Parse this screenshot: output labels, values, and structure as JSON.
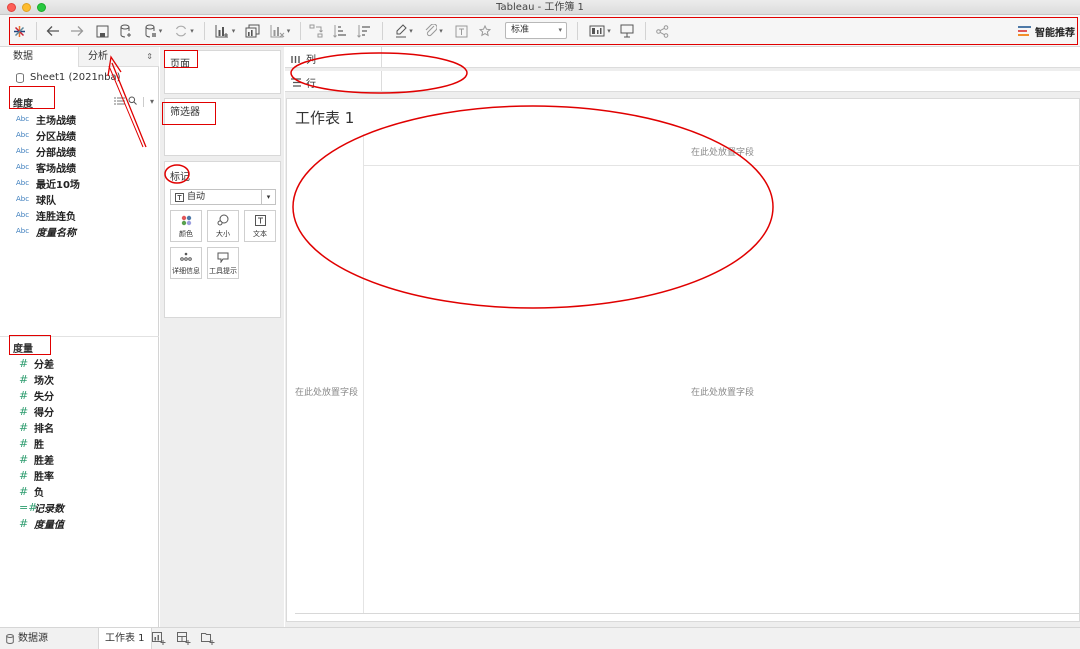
{
  "window": {
    "title": "Tableau - 工作簿 1"
  },
  "toolbar": {
    "fit_value": "标准",
    "show_me_label": "智能推荐",
    "icons": [
      "tableau-logo-icon",
      "undo-icon",
      "redo-icon",
      "save-icon",
      "new-datasource-icon",
      "pause-updates-icon",
      "refresh-icon",
      "new-worksheet-icon",
      "duplicate-sheet-icon",
      "clear-sheet-icon",
      "swap-icon",
      "sort-ascending-icon",
      "sort-descending-icon",
      "highlight-icon",
      "group-icon",
      "label-icon",
      "pin-icon",
      "show-cards-icon",
      "presentation-icon",
      "share-icon"
    ]
  },
  "data_pane": {
    "tab_data": "数据",
    "tab_analysis": "分析",
    "datasource": "Sheet1 (2021nba)",
    "dimensions_title": "维度",
    "dimensions": [
      {
        "type": "Abc",
        "name": "主场战绩",
        "style": "normal"
      },
      {
        "type": "Abc",
        "name": "分区战绩",
        "style": "normal"
      },
      {
        "type": "Abc",
        "name": "分部战绩",
        "style": "normal"
      },
      {
        "type": "Abc",
        "name": "客场战绩",
        "style": "normal"
      },
      {
        "type": "Abc",
        "name": "最近10场",
        "style": "normal"
      },
      {
        "type": "Abc",
        "name": "球队",
        "style": "normal"
      },
      {
        "type": "Abc",
        "name": "连胜连负",
        "style": "normal"
      },
      {
        "type": "Abc",
        "name": "度量名称",
        "style": "italic"
      }
    ],
    "measures_title": "度量",
    "measures": [
      {
        "type": "#",
        "name": "分差",
        "style": "normal"
      },
      {
        "type": "#",
        "name": "场次",
        "style": "normal"
      },
      {
        "type": "#",
        "name": "失分",
        "style": "normal"
      },
      {
        "type": "#",
        "name": "得分",
        "style": "normal"
      },
      {
        "type": "#",
        "name": "排名",
        "style": "normal"
      },
      {
        "type": "#",
        "name": "胜",
        "style": "normal"
      },
      {
        "type": "#",
        "name": "胜差",
        "style": "normal"
      },
      {
        "type": "#",
        "name": "胜率",
        "style": "normal"
      },
      {
        "type": "#",
        "name": "负",
        "style": "normal"
      },
      {
        "type": "=#",
        "name": "记录数",
        "style": "italic"
      },
      {
        "type": "#",
        "name": "度量值",
        "style": "italic"
      }
    ]
  },
  "cards": {
    "pages_title": "页面",
    "filters_title": "筛选器",
    "marks_title": "标记",
    "marks_type": "自动",
    "marks_buttons": {
      "color": "颜色",
      "size": "大小",
      "text": "文本",
      "detail": "详细信息",
      "tooltip": "工具提示"
    }
  },
  "shelves": {
    "columns_label": "列",
    "rows_label": "行"
  },
  "view": {
    "sheet_title": "工作表 1",
    "drop_hint_top": "在此处放置字段",
    "drop_hint_left": "在此处放置字段",
    "drop_hint_center": "在此处放置字段"
  },
  "bottom_tabs": {
    "datasource_tab": "数据源",
    "sheet_tab": "工作表 1"
  },
  "colors": {
    "annotation_red": "#e00000",
    "dimension_blue": "#3d7ebd",
    "measure_green": "#2c9c6e"
  }
}
